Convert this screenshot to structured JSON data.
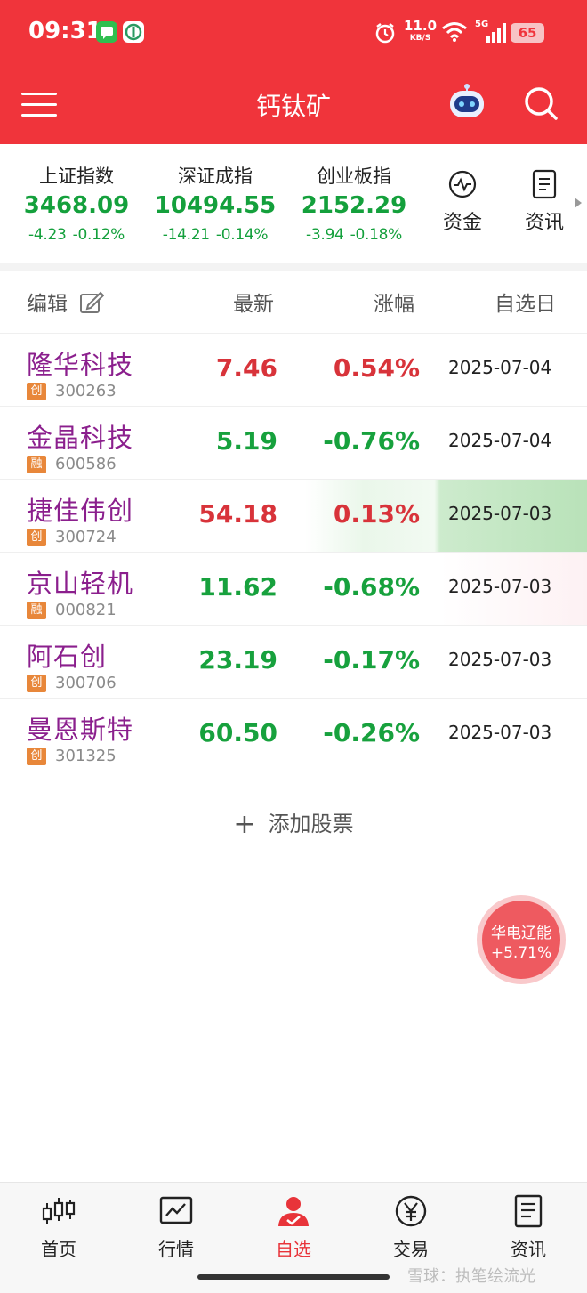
{
  "status_bar": {
    "time": "09:31",
    "speed": "11.0",
    "speed_unit": "KB/S",
    "network": "5G",
    "battery": "65"
  },
  "header": {
    "title": "钙钛矿"
  },
  "indices": [
    {
      "name": "上证指数",
      "value": "3468.09",
      "change": "-4.23",
      "pct": "-0.12%"
    },
    {
      "name": "深证成指",
      "value": "10494.55",
      "change": "-14.21",
      "pct": "-0.14%"
    },
    {
      "name": "创业板指",
      "value": "2152.29",
      "change": "-3.94",
      "pct": "-0.18%"
    }
  ],
  "shortcuts": {
    "funds": "资金",
    "news": "资讯"
  },
  "table_header": {
    "edit": "编辑",
    "latest": "最新",
    "change": "涨幅",
    "date_added": "自选日"
  },
  "stocks": [
    {
      "name": "隆华科技",
      "badge": "创",
      "code": "300263",
      "price": "7.46",
      "pct": "0.54%",
      "date": "2025-07-04"
    },
    {
      "name": "金晶科技",
      "badge": "融",
      "code": "600586",
      "price": "5.19",
      "pct": "-0.76%",
      "date": "2025-07-04"
    },
    {
      "name": "捷佳伟创",
      "badge": "创",
      "code": "300724",
      "price": "54.18",
      "pct": "0.13%",
      "date": "2025-07-03"
    },
    {
      "name": "京山轻机",
      "badge": "融",
      "code": "000821",
      "price": "11.62",
      "pct": "-0.68%",
      "date": "2025-07-03"
    },
    {
      "name": "阿石创",
      "badge": "创",
      "code": "300706",
      "price": "23.19",
      "pct": "-0.17%",
      "date": "2025-07-03"
    },
    {
      "name": "曼恩斯特",
      "badge": "创",
      "code": "301325",
      "price": "60.50",
      "pct": "-0.26%",
      "date": "2025-07-03"
    }
  ],
  "add_stock": "添加股票",
  "floating": {
    "name": "华电辽能",
    "pct": "+5.71%"
  },
  "nav": {
    "home": "首页",
    "market": "行情",
    "watchlist": "自选",
    "trade": "交易",
    "news": "资讯"
  },
  "watermark": "雪球：执笔绘流光",
  "colors": {
    "brand_red": "#f0343b",
    "up": "#d8333a",
    "down": "#17a13d",
    "stock_name": "#8b1f8d",
    "badge_orange": "#e8873a"
  }
}
